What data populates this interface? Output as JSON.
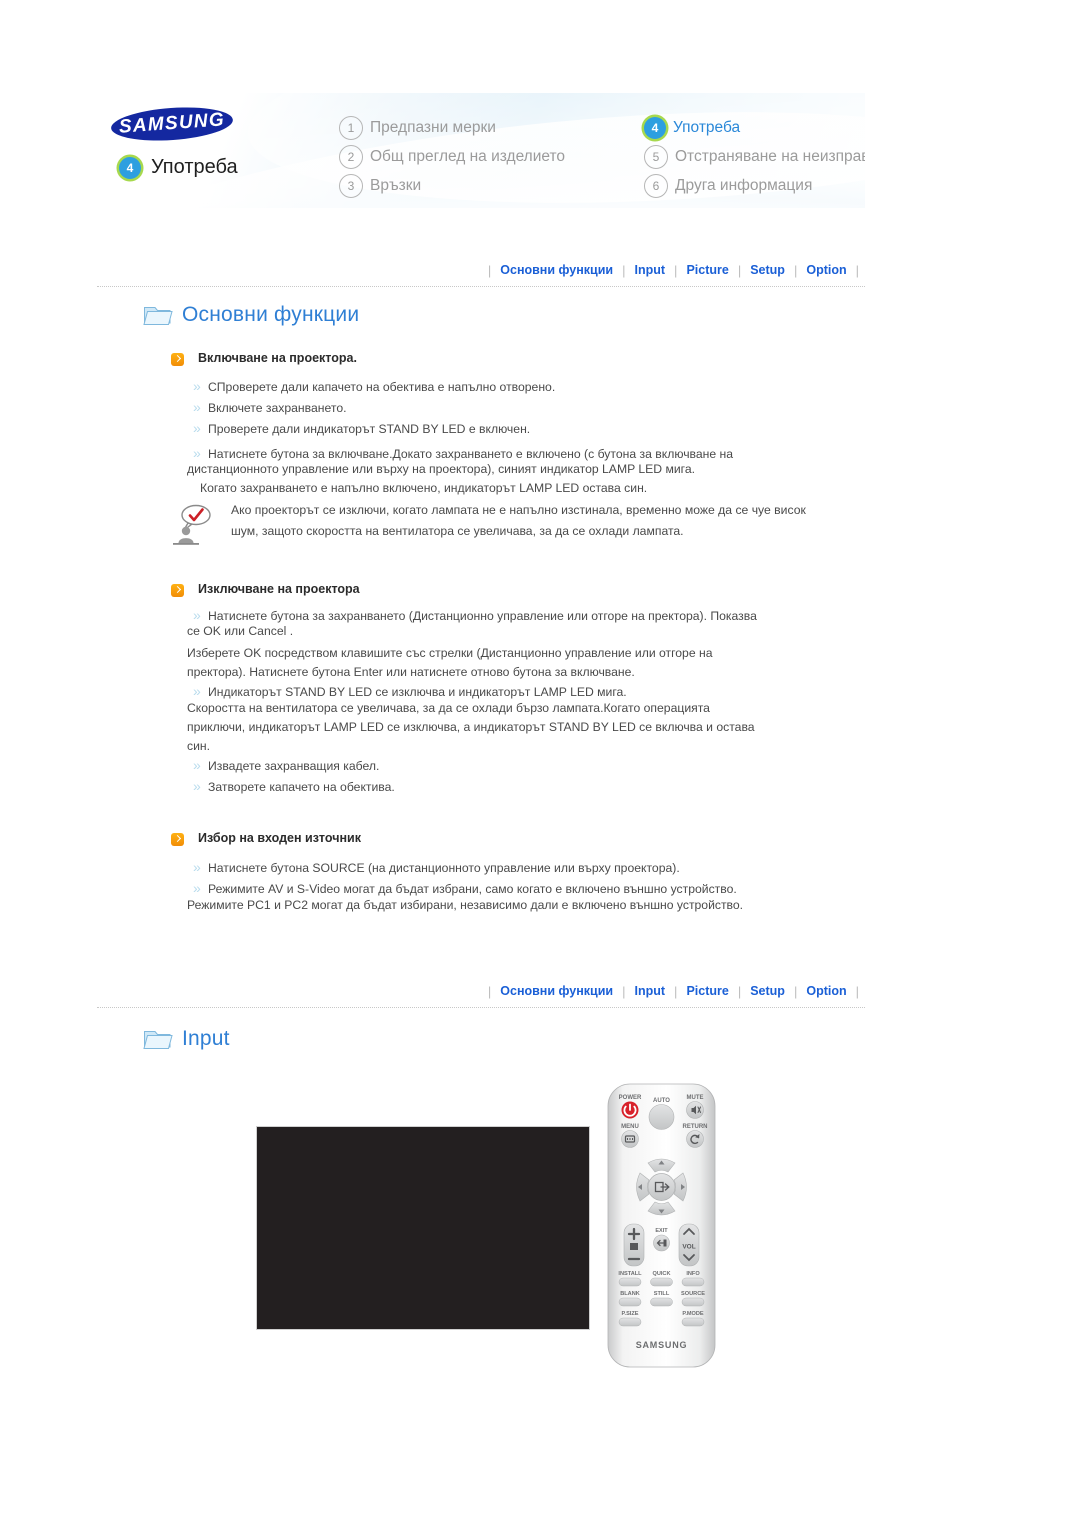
{
  "header": {
    "brand": "SAMSUNG",
    "current_section_number": "4",
    "current_section_label": "Употреба",
    "menu": [
      {
        "number": "1",
        "label": "Предпазни мерки",
        "active": false
      },
      {
        "number": "4",
        "label": "Употреба",
        "active": true
      },
      {
        "number": "2",
        "label": "Общ преглед на изделието",
        "active": false
      },
      {
        "number": "5",
        "label": "Отстраняване на неизправности",
        "active": false
      },
      {
        "number": "3",
        "label": "Връзки",
        "active": false
      },
      {
        "number": "6",
        "label": "Друга информация",
        "active": false
      }
    ]
  },
  "tabs": [
    "Основни функции",
    "Input",
    "Picture",
    "Setup",
    "Option"
  ],
  "section1": {
    "heading": "Основни функции",
    "block1": {
      "title": "Включване на проектора.",
      "items": [
        "СПроверете дали капачето на обектива е напълно отворено.",
        "Включете захранването.",
        "Проверете дали индикаторът STAND BY LED е включен."
      ],
      "item4_line1": "Натиснете бутона за включване.Докато захранването е включено (с бутона за включване на",
      "item4_line2": "дистанционното управление или върху на проектора), синият индикатор LAMP LED мига.",
      "item4_line3": "Когато захранването е напълно включено, индикаторът LAMP LED остава син.",
      "note": "Ако проекторът се изключи, когато лампата не е напълно изстинала, временно може да се чуе висок шум, защото скоростта на вентилатора се увеличава, за да се охлади лампата."
    },
    "block2": {
      "title": "Изключване на проектора",
      "p1_line1": "Натиснете бутона за захранването (Дистанционно управление или отгоре на пректора). Показва",
      "p1_line2": "се OK или Cancel .",
      "p2_line1": "Изберете OK посредством клавишите със стрелки (Дистанционно управление или отгоре на",
      "p2_line2": "пректора). Натиснете бутона Enter или натиснете отново бутона за включване.",
      "p3_line1": "Индикаторът STAND BY LED се изключва и индикаторът LAMP LED мига.",
      "p3_line2": "Скоростта на вентилатора се увеличава, за да се охлади бързо лампата.Когато операцията",
      "p3_line3": "приключи, индикаторът LAMP LED се изключва, а индикаторът STAND BY LED се включва и остава",
      "p3_line4": "син.",
      "items": [
        "Извадете захранващия кабел.",
        "Затворете капачето на обектива."
      ]
    },
    "block3": {
      "title": "Избор на входен източник",
      "item1": "Натиснете бутона SOURCE (на дистанционното управление или върху проектора).",
      "item2_line1": "Режимите AV и S-Video могат да бъдат избрани, само когато е включено външно устройство.",
      "item2_line2": "Режимите PC1 и PC2 могат да бъдат избирани, независимо дали е включено външно устройство."
    }
  },
  "section2": {
    "heading": "Input"
  },
  "remote": {
    "brand": "SAMSUNG",
    "power_label": "POWER",
    "auto_label": "AUTO",
    "mute_label": "MUTE",
    "menu_label": "MENU",
    "return_label": "RETURN",
    "exit_label": "EXIT",
    "vol_label": "VOL",
    "buttons": [
      "INSTALL",
      "QUICK",
      "INFO",
      "BLANK",
      "STILL",
      "SOURCE",
      "P.SIZE",
      "P.MODE"
    ]
  },
  "colors": {
    "link_blue": "#1a5fd6",
    "heading_blue": "#2f7fd4",
    "marker_orange": "#f5a012",
    "badge_blue": "#2d9fe0",
    "badge_ring_green": "#a7d94d",
    "panel_black": "#231f20",
    "samsung_navy": "#1428a0"
  }
}
